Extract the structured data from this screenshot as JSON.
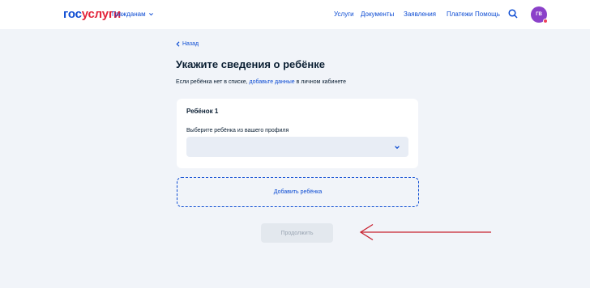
{
  "header": {
    "logo_part1": "гос",
    "logo_part2": "услуги",
    "citizen_menu": "Гражданам",
    "nav": [
      "Услуги",
      "Документы",
      "Заявления",
      "Платежи",
      "Помощь"
    ],
    "avatar_initials": "ГВ"
  },
  "main": {
    "back_label": "Назад",
    "title": "Укажите сведения о ребёнке",
    "subtitle_before": "Если ребёнка нет в списке, ",
    "subtitle_link": "добавьте данные",
    "subtitle_after": " в личном кабинете",
    "card": {
      "title": "Ребёнок 1",
      "field_label": "Выберите ребёнка из вашего профиля",
      "selected_value": ""
    },
    "add_child_label": "Добавить ребёнка",
    "continue_label": "Продолжить"
  },
  "colors": {
    "accent": "#0d4cd3",
    "brand_red": "#e3233a",
    "annotation_arrow": "#c8202f",
    "avatar": "#8b41c9"
  }
}
